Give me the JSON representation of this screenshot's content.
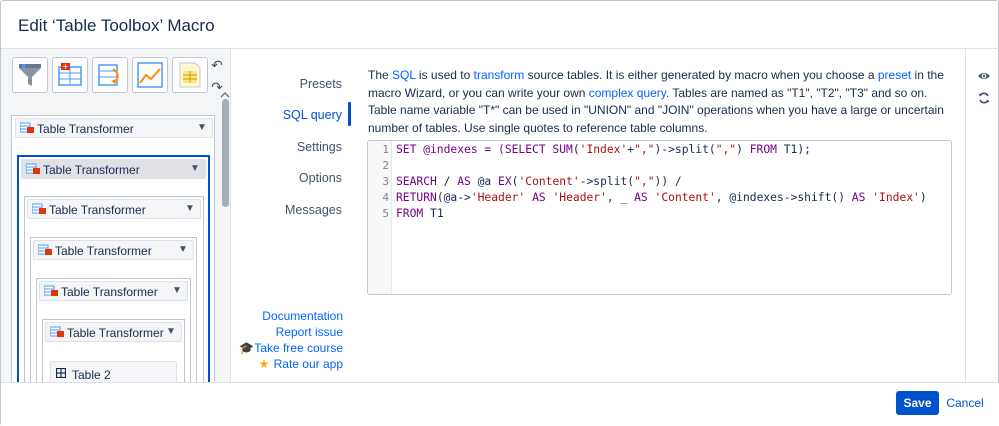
{
  "dialog": {
    "title": "Edit ‘Table Toolbox’ Macro"
  },
  "toolbar": {
    "tools": [
      {
        "icon": "filter-funnel-icon"
      },
      {
        "icon": "table-add-column-icon"
      },
      {
        "icon": "table-transform-icon"
      },
      {
        "icon": "line-chart-icon"
      },
      {
        "icon": "spreadsheet-icon"
      }
    ],
    "undo_glyph": "↶",
    "redo_glyph": "↷"
  },
  "tree": {
    "nodes": [
      {
        "label": "Table Transformer"
      },
      {
        "label": "Table Transformer"
      },
      {
        "label": "Table Transformer"
      },
      {
        "label": "Table Transformer"
      },
      {
        "label": "Table Transformer"
      },
      {
        "label": "Table Transformer"
      }
    ],
    "leaf": {
      "label": "Table 2"
    }
  },
  "nav": {
    "items": [
      {
        "label": "Presets"
      },
      {
        "label": "SQL query"
      },
      {
        "label": "Settings"
      },
      {
        "label": "Options"
      },
      {
        "label": "Messages"
      }
    ],
    "active_index": 1,
    "links": {
      "documentation": "Documentation",
      "report_issue": "Report issue",
      "free_course": "Take free course",
      "rate_app": "Rate our app"
    }
  },
  "main": {
    "desc": {
      "p1": "The ",
      "link_sql": "SQL",
      "p2": " is used to ",
      "link_transform": "transform",
      "p3": " source tables. It is either generated by macro when you choose a ",
      "link_preset": "preset",
      "p4": " in the macro Wizard, or you can write your own ",
      "link_complex": "complex query",
      "p5": ". Tables are named as \"T1\", \"T2\", \"T3\" and so on. Table name variable \"T*\" can be used in \"UNION\" and \"JOIN\" operations when you have a large or uncertain number of tables. Use single quotes to reference table columns."
    },
    "editor": {
      "line_numbers": [
        "1",
        "2",
        "3",
        "4",
        "5"
      ],
      "line1": {
        "a": "SET @indexes = (",
        "b": "SELECT SUM",
        "c": "(",
        "d": "'Index'",
        "e": "+",
        "f": "\",\"",
        "g": ")->split(",
        "h": "\",\"",
        "i": ") ",
        "j": "FROM",
        "k": " T1);"
      },
      "line3": {
        "a": "SEARCH",
        "b": " / ",
        "c": "AS",
        "d": " @a ",
        "e": "EX",
        "f": "(",
        "g": "'Content'",
        "h": "->split(",
        "i": "\",\"",
        "j": ")) /"
      },
      "line4": {
        "a": "RETURN",
        "b": "(@a->",
        "c": "'Header'",
        "d": " ",
        "e": "AS",
        "f": " ",
        "g": "'Header'",
        "h": ", _ ",
        "i": "AS",
        "j": " ",
        "k": "'Content'",
        "l": ", @indexes->shift() ",
        "m": "AS",
        "n": " ",
        "o": "'Index'",
        "p": ")"
      },
      "line5": {
        "a": "FROM",
        "b": " T1"
      }
    }
  },
  "footer": {
    "save": "Save",
    "cancel": "Cancel"
  },
  "colors": {
    "accent": "#0052cc",
    "link": "#0065ff",
    "keyword": "#770088",
    "string": "#aa1111"
  }
}
